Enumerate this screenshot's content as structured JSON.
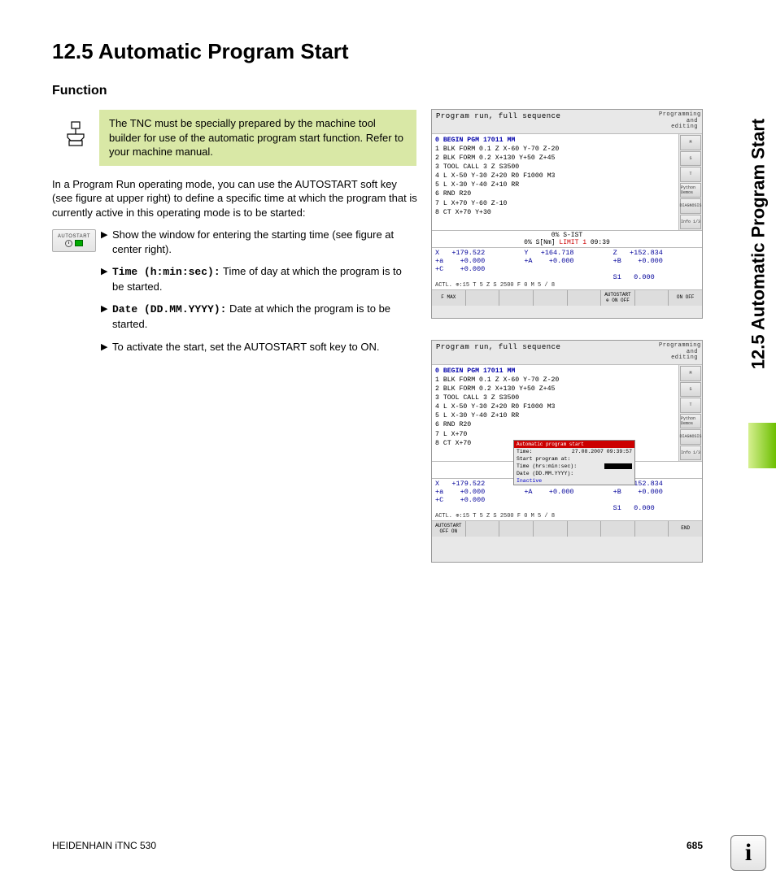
{
  "heading": "12.5  Automatic Program Start",
  "subheading": "Function",
  "note": "The TNC must be specially prepared by the machine tool builder for use of the automatic program start function. Refer to your machine manual.",
  "intro": "In a Program Run operating mode, you can use the AUTOSTART soft key (see figure at upper right) to define a specific time at which the program that is currently active in this operating mode is to be started:",
  "softkey_label": "AUTOSTART",
  "steps": [
    {
      "pre": "",
      "bold": "",
      "text": "Show the window for entering the starting time (see figure at center right)."
    },
    {
      "pre": "",
      "bold": "Time (h:min:sec):",
      "text": " Time of day at which the program is to be started."
    },
    {
      "pre": "",
      "bold": "Date (DD.MM.YYYY):",
      "text": " Date at which the program is to be started."
    },
    {
      "pre": "",
      "bold": "",
      "text": "To activate the start, set the AUTOSTART soft key to ON."
    }
  ],
  "side_tab": "12.5 Automatic Program Start",
  "shot_header_main": "Program run, full sequence",
  "shot_header_sub": "Programming and editing",
  "prog_lines": [
    "0   BEGIN PGM 17011 MM",
    "1   BLK FORM 0.1 Z  X-60  Y-70  Z-20",
    "2   BLK FORM 0.2  X+130  Y+50  Z+45",
    "3   TOOL CALL 3 Z S3500",
    "4   L   X-50  Y-30  Z+20 R0 F1000 M3",
    "5   L   X-30  Y-40  Z+10 RR",
    "6   RND R20",
    "7   L   X+70  Y-60  Z-10",
    "8   CT  X+70  Y+30"
  ],
  "prog_lines2": [
    "0   BEGIN PGM 17011 MM",
    "1   BLK FORM 0.1 Z  X-60  Y-70  Z-20",
    "2   BLK FORM 0.2  X+130  Y+50  Z+45",
    "3   TOOL CALL 3 Z S3500",
    "4   L   X-50  Y-30  Z+20 R0 F1000 M3",
    "5   L   X-30  Y-40  Z+10 RR",
    "6   RND R20",
    "7   L   X+70",
    "8   CT  X+70"
  ],
  "side_buttons": [
    "M",
    "S",
    "T",
    "Python Demos",
    "DIAGNOSIS",
    "Info 1/3"
  ],
  "status_line1": "0% S-IST",
  "status_line2a": "0% S[Nm]",
  "status_limit": "LIMIT 1",
  "status_time": "09:39",
  "coords": {
    "r1": [
      "X   +179.522",
      "Y   +164.718",
      "Z   +152.834"
    ],
    "r2": [
      "+a    +0.000",
      "+A    +0.000",
      "+B    +0.000"
    ],
    "r3": [
      "+C    +0.000",
      "",
      ""
    ],
    "r4": [
      "",
      "",
      "S1   0.000"
    ]
  },
  "actl_row": "ACTL.        ⊕:15      T 5      Z S 2500     F 0      M 5 / 8",
  "footer1": [
    "F MAX",
    "",
    "",
    "",
    "",
    "AUTOSTART ⊕ ON OFF",
    "",
    "ON OFF"
  ],
  "footer2": [
    "AUTOSTART OFF  ON",
    "",
    "",
    "",
    "",
    "",
    "",
    "END"
  ],
  "dialog": {
    "title": "Automatic program start",
    "rows": [
      [
        "Time:",
        "27.08.2007 09:39:57"
      ],
      [
        "Start program at:",
        ""
      ],
      [
        "Time (hrs:min:sec):",
        ""
      ],
      [
        "Date (DD.MM.YYYY):",
        ""
      ]
    ],
    "inactive": "Inactive"
  },
  "footer_product": "HEIDENHAIN iTNC 530",
  "footer_page": "685",
  "info_glyph": "i"
}
